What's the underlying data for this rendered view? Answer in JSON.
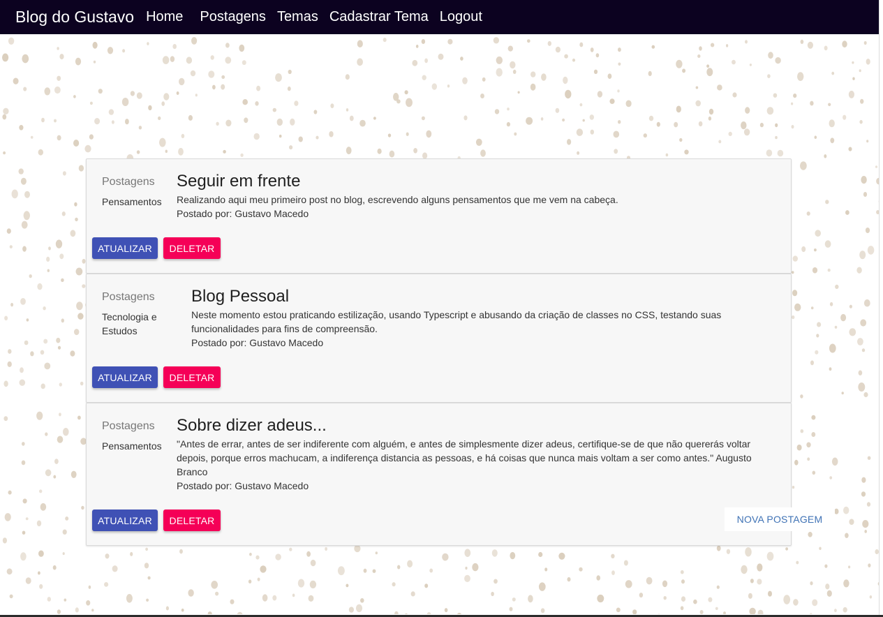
{
  "navbar": {
    "brand": "Blog do Gustavo",
    "links": [
      "Home",
      "Postagens",
      "Temas",
      "Cadastrar Tema",
      "Logout"
    ]
  },
  "posts": [
    {
      "section_label": "Postagens",
      "theme": "Pensamentos",
      "title": "Seguir em frente",
      "text": "Realizando aqui meu primeiro post no blog, escrevendo alguns pensamentos que me vem na cabeça.",
      "author": "Postado por: Gustavo Macedo",
      "update_label": "ATUALIZAR",
      "delete_label": "DELETAR"
    },
    {
      "section_label": "Postagens",
      "theme": "Tecnologia e Estudos",
      "title": "Blog Pessoal",
      "text": "Neste momento estou praticando estilização, usando Typescript e abusando da criação de classes no CSS, testando suas funcionalidades para fins de compreensão.",
      "author": "Postado por: Gustavo Macedo",
      "update_label": "ATUALIZAR",
      "delete_label": "DELETAR"
    },
    {
      "section_label": "Postagens",
      "theme": "Pensamentos",
      "title": "Sobre dizer adeus...",
      "text": "\"Antes de errar, antes de ser indiferente com alguém, e antes de simplesmente dizer adeus, certifique-se de que não quererás voltar depois, porque erros machucam, a indiferença distancia as pessoas, e há coisas que nunca mais voltam a ser como antes.\" Augusto Branco",
      "author": "Postado por: Gustavo Macedo",
      "update_label": "ATUALIZAR",
      "delete_label": "DELETAR"
    }
  ],
  "new_post_label": "NOVA POSTAGEM",
  "colors": {
    "navbar_bg": "#0c0220",
    "update_button": "#3f51b5",
    "delete_button": "#f50057",
    "dot_color": "#d9ccba"
  }
}
